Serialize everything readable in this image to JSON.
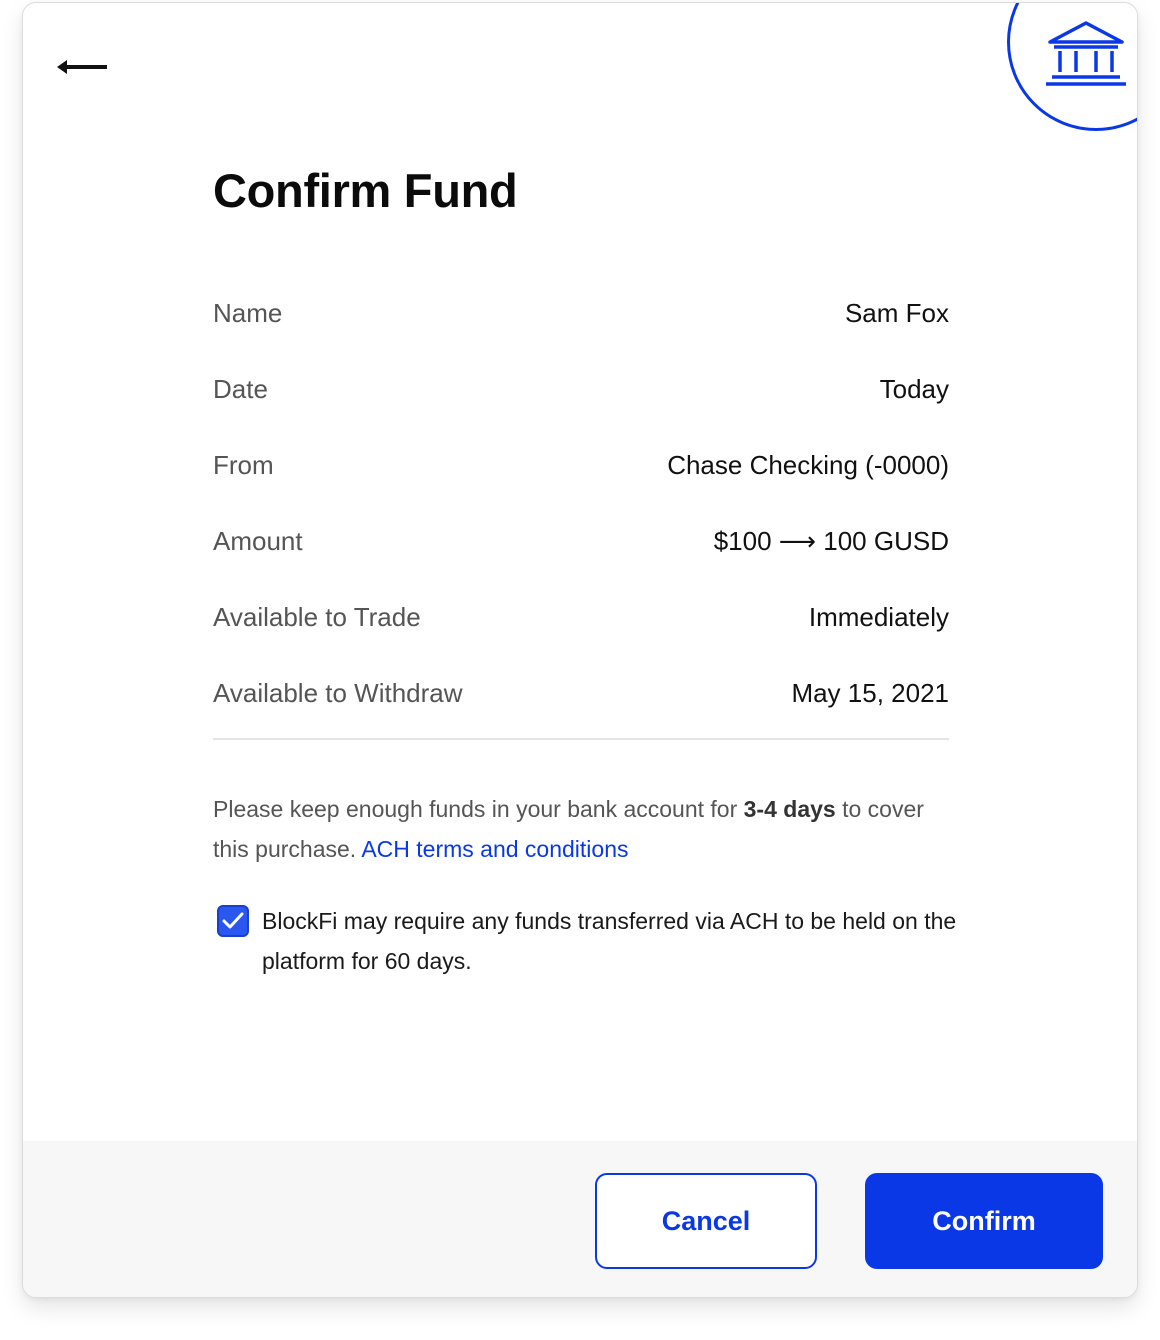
{
  "header": {
    "back_icon": "arrow-left-icon",
    "bank_icon": "bank-icon"
  },
  "title": "Confirm Fund",
  "details": [
    {
      "label": "Name",
      "value": "Sam Fox"
    },
    {
      "label": "Date",
      "value": "Today"
    },
    {
      "label": "From",
      "value": "Chase Checking (-0000)"
    },
    {
      "label": "Amount",
      "value": "$100 ⟶ 100 GUSD"
    },
    {
      "label": "Available to Trade",
      "value": "Immediately"
    },
    {
      "label": "Available to Withdraw",
      "value": "May 15, 2021"
    }
  ],
  "notice": {
    "text_before": "Please keep enough funds in your bank account for ",
    "bold": "3-4 days",
    "text_after": " to cover this purchase. ",
    "link": "ACH terms and conditions"
  },
  "agreement": {
    "checked": true,
    "text": "BlockFi may require any funds transferred via ACH to be held on the platform for 60 days."
  },
  "buttons": {
    "cancel": "Cancel",
    "confirm": "Confirm"
  },
  "colors": {
    "accent": "#0a38e6",
    "checkbox": "#2a57f0",
    "label": "#555555",
    "footer_bg": "#f7f7f7"
  }
}
